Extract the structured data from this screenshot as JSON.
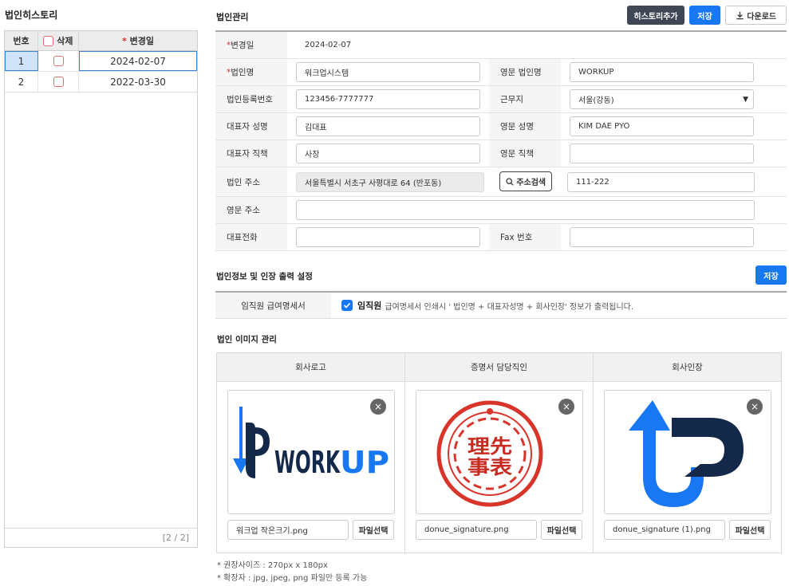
{
  "left": {
    "title": "법인히스토리",
    "columns": {
      "no": "번호",
      "delete": "삭제",
      "change_date": "변경일",
      "required_mark": "*"
    },
    "rows": [
      {
        "no": "1",
        "date": "2024-02-07"
      },
      {
        "no": "2",
        "date": "2022-03-30"
      }
    ],
    "pagination": "[2 / 2]"
  },
  "corp": {
    "title": "법인관리",
    "btn_history_add": "히스토리추가",
    "btn_save": "저장",
    "btn_download": "다운로드",
    "fields": {
      "change_date_label": "변경일",
      "change_date_value": "2024-02-07",
      "name_label": "법인명",
      "name_value": "워크업시스템",
      "eng_name_label": "영문 법인명",
      "eng_name_value": "WORKUP",
      "reg_no_label": "법인등록번호",
      "reg_no_value": "123456-7777777",
      "workplace_label": "근무지",
      "workplace_value": "서울(강동)",
      "ceo_name_label": "대표자 성명",
      "ceo_name_value": "김대표",
      "eng_ceo_name_label": "영문 성명",
      "eng_ceo_name_value": "KIM DAE PYO",
      "ceo_title_label": "대표자 직책",
      "ceo_title_value": "사장",
      "eng_title_label": "영문 직책",
      "eng_title_value": "",
      "address_label": "법인 주소",
      "address_value": "서울특별시 서초구 사평대로 64 (반포동)",
      "address_search_btn": "주소검색",
      "zip_value": "111-222",
      "eng_address_label": "영문 주소",
      "eng_address_value": "",
      "phone_label": "대표전화",
      "phone_value": "",
      "fax_label": "Fax 번호",
      "fax_value": ""
    }
  },
  "print": {
    "title": "법인정보 및 인장 출력 설정",
    "btn_save": "저장",
    "row_label": "임직원 급여명세서",
    "check_bold": "임직원",
    "check_text": "급여명세서 인쇄시 ' 법인명 + 대표자성명 + 회사인장' 정보가 출력됩니다."
  },
  "images": {
    "title": "법인 이미지 관리",
    "columns": [
      "회사로고",
      "증명서 담당직인",
      "회사인장"
    ],
    "files": [
      "워크업 작은크기.png",
      "donue_signature.png",
      "donue_signature (1).png"
    ],
    "file_btn": "파일선택",
    "logo_text": "WORKUP",
    "seal_text": "理先事表",
    "notes": [
      "* 권장사이즈 : 270px x 180px",
      "* 확장자 : jpg, jpeg, png 파일만 등록 가능"
    ]
  },
  "colors": {
    "accent": "#1877f2",
    "dark_button": "#3f4755",
    "seal_red": "#d8342a",
    "logo_navy": "#14284a"
  }
}
